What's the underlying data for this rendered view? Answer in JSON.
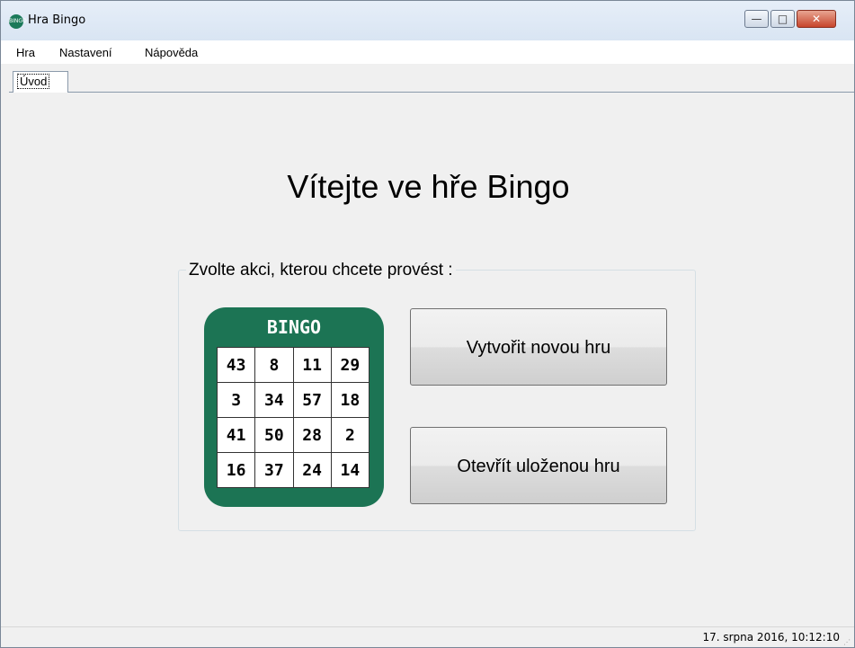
{
  "window": {
    "title": "Hra Bingo",
    "app_icon_text": "BINGO",
    "controls": {
      "minimize": "—",
      "maximize": "□",
      "close": "✕"
    }
  },
  "menu": [
    "Hra",
    "Nastavení",
    "Nápověda"
  ],
  "tabs": [
    {
      "label": "Úvod",
      "selected": true
    }
  ],
  "main": {
    "welcome": "Vítejte ve hře Bingo",
    "group_caption": "Zvolte akci, kterou chcete provést :",
    "bingo_card": {
      "title": "BINGO",
      "rows": [
        [
          "43",
          "8",
          "11",
          "29"
        ],
        [
          "3",
          "34",
          "57",
          "18"
        ],
        [
          "41",
          "50",
          "28",
          "2"
        ],
        [
          "16",
          "37",
          "24",
          "14"
        ]
      ]
    },
    "buttons": {
      "new_game": "Vytvořit novou hru",
      "open_game": "Otevřít uloženou hru"
    }
  },
  "statusbar": {
    "datetime": "17. srpna 2016, 10:12:10"
  },
  "colors": {
    "card_green": "#1c7454",
    "titlebar": "#dbe6f4",
    "close_red": "#c7452b"
  }
}
